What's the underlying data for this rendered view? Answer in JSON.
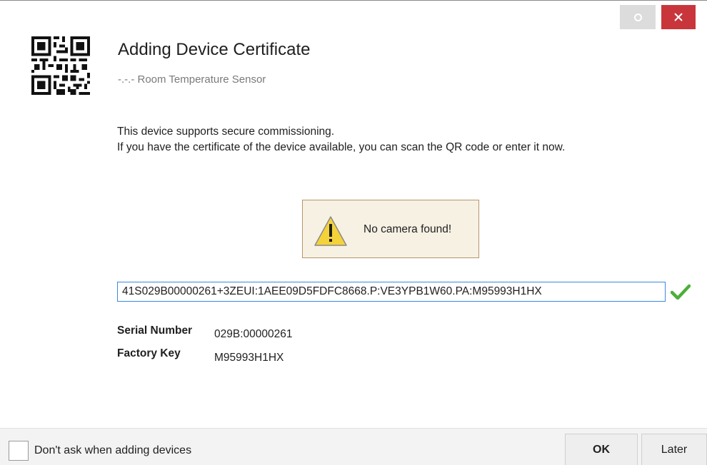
{
  "window": {
    "restore_icon": "restore-icon",
    "close_icon": "close-icon",
    "close_color": "#c8363c"
  },
  "header": {
    "icon": "qr-code-icon",
    "title": "Adding Device Certificate",
    "subtitle": "-.-.- Room Temperature Sensor"
  },
  "intro": {
    "line1": "This device supports secure commissioning.",
    "line2": "If you have the certificate of the device available, you can scan the QR code or enter it now."
  },
  "warning": {
    "icon": "warning-icon",
    "text": "No camera found!"
  },
  "certificate": {
    "value": "41S029B00000261+3ZEUI:1AEE09D5FDFC8668.P:VE3YPB1W60.PA:M95993H1HX",
    "valid_icon": "checkmark-icon",
    "valid_color": "#4caf3a"
  },
  "details": {
    "serial_label": "Serial Number",
    "serial_value": "029B:00000261",
    "factory_key_label": "Factory Key",
    "factory_key_value": "M95993H1HX"
  },
  "footer": {
    "dont_ask_label": "Don't ask when adding devices",
    "dont_ask_checked": false,
    "ok_label": "OK",
    "later_label": "Later"
  }
}
